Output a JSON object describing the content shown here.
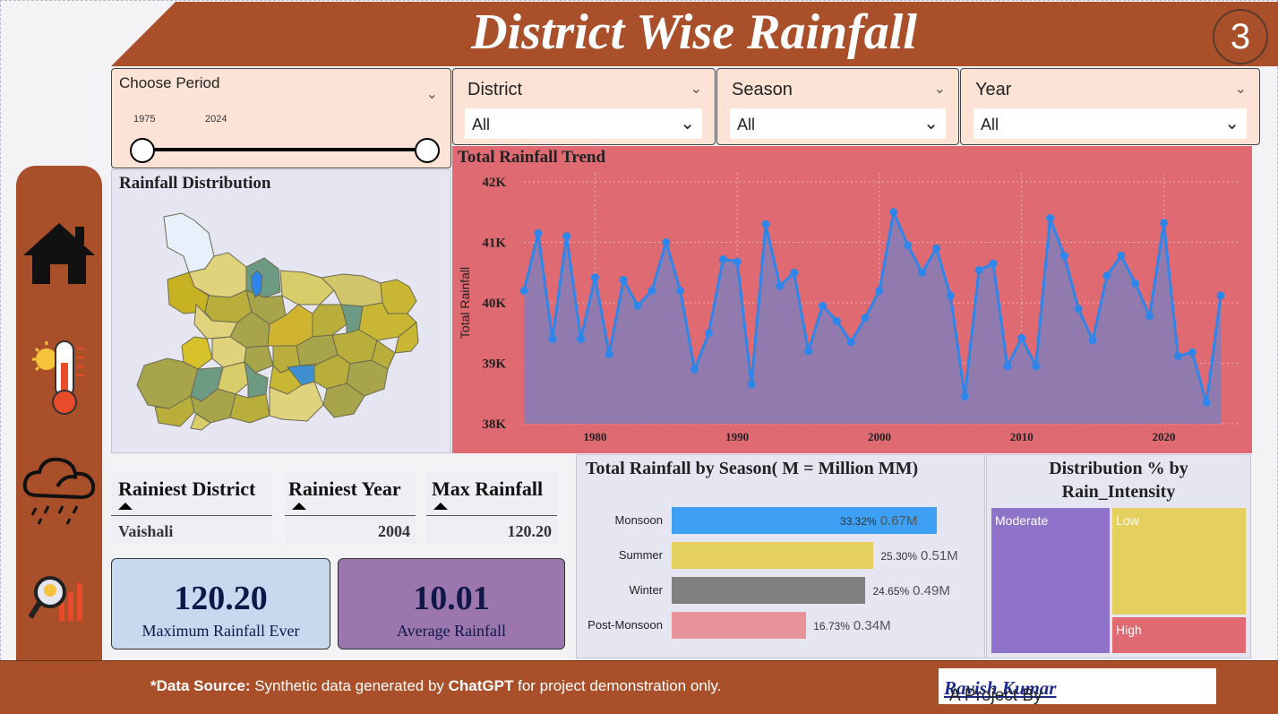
{
  "title": "District Wise Rainfall",
  "page_number": "3",
  "colors": {
    "brand": "#a9502a",
    "slicer_bg": "#fde3d6",
    "trend_bg": "#e06a72",
    "area": "#8c7bb0",
    "line": "#2f86ea"
  },
  "period": {
    "label": "Choose Period",
    "start": "1975",
    "end": "2024"
  },
  "slicers": [
    {
      "label": "District",
      "value": "All"
    },
    {
      "label": "Season",
      "value": "All"
    },
    {
      "label": "Year",
      "value": "All"
    }
  ],
  "map": {
    "title": "Rainfall Distribution"
  },
  "trend": {
    "title": "Total Rainfall Trend",
    "ylabel": "Total Rainfall",
    "y_ticks": [
      "42K",
      "41K",
      "40K",
      "39K",
      "38K"
    ],
    "x_ticks": [
      "1980",
      "1990",
      "2000",
      "2010",
      "2020"
    ]
  },
  "chart_data": [
    {
      "type": "area",
      "title": "Total Rainfall Trend",
      "ylabel": "Total Rainfall",
      "ylim": [
        38000,
        42000
      ],
      "x": [
        1975,
        1976,
        1977,
        1978,
        1979,
        1980,
        1981,
        1982,
        1983,
        1984,
        1985,
        1986,
        1987,
        1988,
        1989,
        1990,
        1991,
        1992,
        1993,
        1994,
        1995,
        1996,
        1997,
        1998,
        1999,
        2000,
        2001,
        2002,
        2003,
        2004,
        2005,
        2006,
        2007,
        2008,
        2009,
        2010,
        2011,
        2012,
        2013,
        2014,
        2015,
        2016,
        2017,
        2018,
        2019,
        2020,
        2021,
        2022,
        2023,
        2024
      ],
      "values": [
        40200,
        41150,
        39400,
        41100,
        39400,
        40420,
        39150,
        40380,
        39950,
        40200,
        41000,
        40200,
        38900,
        39500,
        40720,
        40680,
        38650,
        41300,
        40280,
        40500,
        39200,
        39950,
        39700,
        39350,
        39750,
        40200,
        41500,
        40950,
        40500,
        40900,
        40120,
        38450,
        40540,
        40650,
        38950,
        39420,
        38950,
        41400,
        40780,
        39900,
        39380,
        40450,
        40780,
        40320,
        39780,
        41320,
        39120,
        39180,
        38350,
        40120
      ]
    },
    {
      "type": "bar",
      "title": "Total Rainfall by Season( M = Million MM)",
      "categories": [
        "Monsoon",
        "Summer",
        "Winter",
        "Post-Monsoon"
      ],
      "values": [
        0.67,
        0.51,
        0.49,
        0.34
      ],
      "percent": [
        "33.32%",
        "25.30%",
        "24.65%",
        "16.73%"
      ],
      "labels": [
        "0.67M",
        "0.51M",
        "0.49M",
        "0.34M"
      ],
      "colors": [
        "#3da0f4",
        "#e5cf5e",
        "#808080",
        "#e8929a"
      ]
    },
    {
      "type": "treemap",
      "title": "Distribution % by Rain_Intensity",
      "categories": [
        "Moderate",
        "Low",
        "High"
      ],
      "colors": [
        "#8f72c9",
        "#e5cf5e",
        "#e06a72"
      ]
    }
  ],
  "season": {
    "title": "Total Rainfall by Season( M = Million MM)"
  },
  "intensity": {
    "title_line1": "Distribution % by",
    "title_line2": "Rain_Intensity"
  },
  "stats": [
    {
      "header": "Rainiest District",
      "value": "Vaishali"
    },
    {
      "header": "Rainiest Year",
      "value": "2004"
    },
    {
      "header": "Max Rainfall",
      "value": "120.20"
    }
  ],
  "kpis": [
    {
      "value": "120.20",
      "label": "Maximum Rainfall Ever"
    },
    {
      "value": "10.01",
      "label": "Average Rainfall"
    }
  ],
  "footer": {
    "source_bold": "*Data Source:",
    "source_text": " Synthetic data generated by ",
    "source_bold2": "ChatGPT",
    "source_text2": " for project demonstration only.",
    "credit_prefix": "A Project By ",
    "credit_name": "Ravish Kumar"
  },
  "nav": [
    "home-icon",
    "temperature-icon",
    "rain-cloud-icon",
    "analysis-icon"
  ]
}
